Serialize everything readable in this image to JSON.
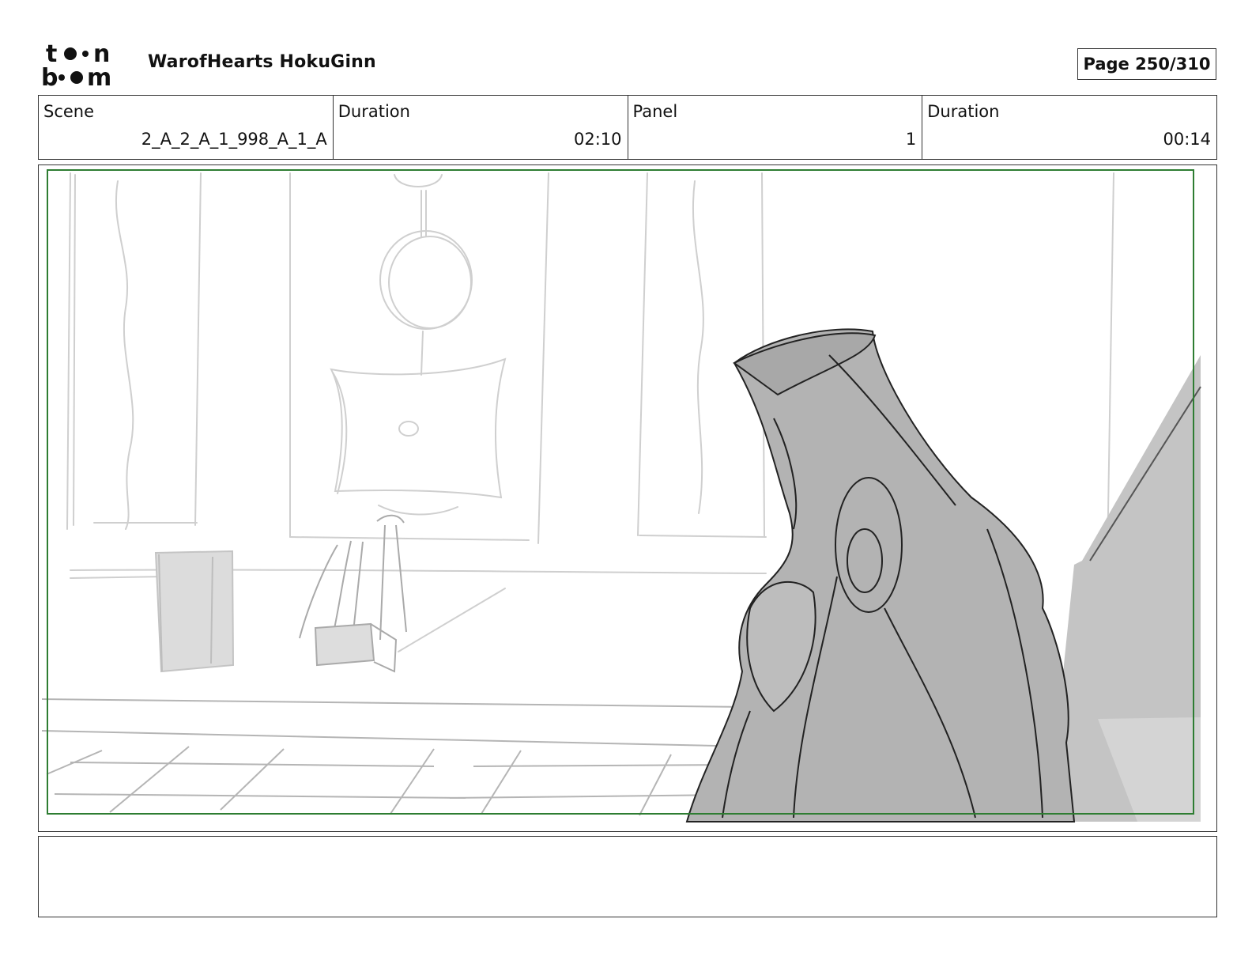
{
  "header": {
    "logo_text": "toon boom",
    "project_title": "WarofHearts HokuGinn",
    "page_label": "Page 250/310"
  },
  "info": {
    "scene_label": "Scene",
    "scene_value": "2_A_2_A_1_998_A_1_A",
    "scene_duration_label": "Duration",
    "scene_duration_value": "02:10",
    "panel_label": "Panel",
    "panel_value": "1",
    "panel_duration_label": "Duration",
    "panel_duration_value": "00:14"
  },
  "panel": {
    "safe_frame_color": "#2e7d32",
    "sketch_light_color": "#c8c8c8",
    "figure_fill_color": "#b3b3b3"
  },
  "notes": {
    "text": ""
  }
}
